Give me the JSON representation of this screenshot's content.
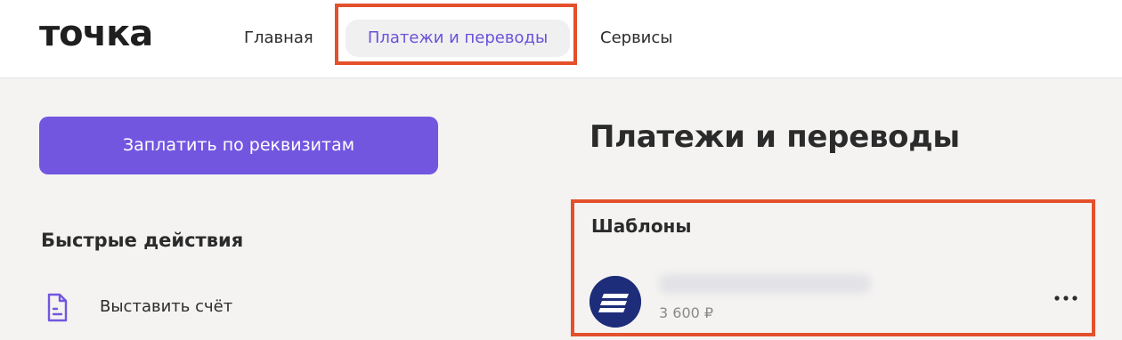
{
  "header": {
    "logo": "точка",
    "nav": {
      "home": "Главная",
      "payments": "Платежи и переводы",
      "services": "Сервисы"
    }
  },
  "left": {
    "pay_button": "Заплатить по реквизитам",
    "quick_actions_title": "Быстрые действия",
    "quick_actions": [
      {
        "label": "Выставить счёт",
        "icon": "document-icon"
      }
    ]
  },
  "main": {
    "title": "Платежи и переводы",
    "templates_title": "Шаблоны",
    "templates": [
      {
        "name": "",
        "amount": "3 600 ₽",
        "icon": "bank-logo-icon"
      }
    ]
  },
  "colors": {
    "accent": "#7256e0",
    "nav_active_text": "#6a52d9",
    "highlight": "#e3502b",
    "bank_logo": "#1d2d7a"
  }
}
